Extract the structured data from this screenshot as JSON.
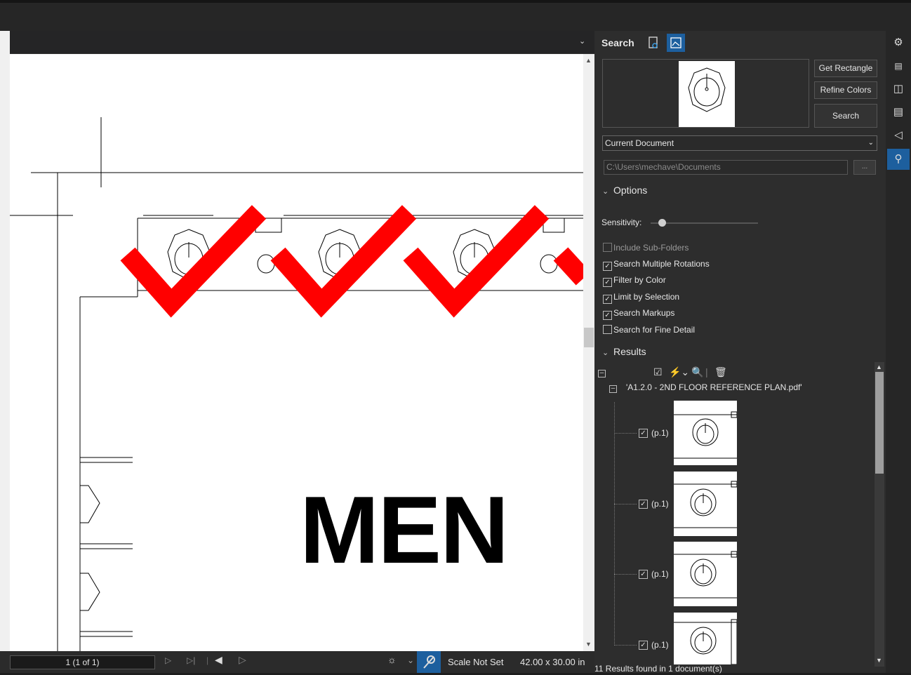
{
  "document": {
    "sign_text": "MEN"
  },
  "statusbar": {
    "page_value": "1 (1 of 1)",
    "scale_label": "Scale Not Set",
    "page_size": "42.00 x 30.00 in"
  },
  "search_panel": {
    "title": "Search",
    "buttons": {
      "get_rectangle": "Get Rectangle",
      "refine_colors": "Refine Colors",
      "search": "Search"
    },
    "scope_selected": "Current Document",
    "folder_path": "C:\\Users\\mechave\\Documents",
    "browse_label": "...",
    "options_header": "Options",
    "sensitivity_label": "Sensitivity:",
    "sensitivity_level": 0.1,
    "checkboxes": [
      {
        "label": "Include Sub-Folders",
        "checked": false,
        "enabled": false
      },
      {
        "label": "Search Multiple Rotations",
        "checked": true,
        "enabled": true
      },
      {
        "label": "Filter by Color",
        "checked": true,
        "enabled": true
      },
      {
        "label": "Limit by Selection",
        "checked": true,
        "enabled": true
      },
      {
        "label": "Search Markups",
        "checked": true,
        "enabled": true
      },
      {
        "label": "Search for Fine Detail",
        "checked": false,
        "enabled": true
      }
    ],
    "results_header": "Results",
    "result_file": "'A1.2.0 - 2ND FLOOR REFERENCE PLAN.pdf'",
    "results": [
      {
        "label": "(p.1)",
        "checked": true
      },
      {
        "label": "(p.1)",
        "checked": true
      },
      {
        "label": "(p.1)",
        "checked": true
      },
      {
        "label": "(p.1)",
        "checked": true
      }
    ],
    "footer": "11 Results found in 1 document(s)"
  },
  "rail": [
    "settings-icon",
    "ruler-icon",
    "markup-list-icon",
    "stamp-icon",
    "tag-icon",
    "search-icon"
  ],
  "colors": {
    "accent": "#1d5f9e",
    "checkmark": "#ff0000"
  }
}
